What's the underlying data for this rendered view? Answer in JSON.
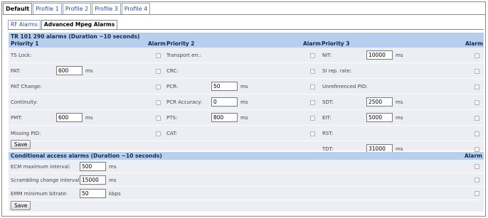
{
  "outer_tabs": [
    "Default",
    "Profile 1",
    "Profile 2",
    "Profile 3",
    "Profile 4"
  ],
  "inner_tabs": [
    "RF Alarms",
    "Advanced Mpeg Alarms"
  ],
  "tr101": {
    "title": "TR 101 290 alarms (Duration ~10 seconds)",
    "headers": {
      "p1": "Priority 1",
      "p2": "Priority 2",
      "p3": "Priority 3",
      "alarm1": "Alarm",
      "alarm2": "Alarm",
      "alarm3": "Alarm"
    },
    "p1": [
      {
        "label": "TS Lock:",
        "value": null,
        "unit": ""
      },
      {
        "label": "PAT:",
        "value": "600",
        "unit": "ms"
      },
      {
        "label": "PAT Change:",
        "value": null,
        "unit": ""
      },
      {
        "label": "Continuity:",
        "value": null,
        "unit": ""
      },
      {
        "label": "PMT:",
        "value": "600",
        "unit": "ms"
      },
      {
        "label": "Missing PID:",
        "value": null,
        "unit": ""
      }
    ],
    "p2": [
      {
        "label": "Transport err.:",
        "value": null,
        "unit": ""
      },
      {
        "label": "CRC:",
        "value": null,
        "unit": ""
      },
      {
        "label": "PCR:",
        "value": "50",
        "unit": "ms"
      },
      {
        "label": "PCR Accuracy:",
        "value": "0",
        "unit": "ms"
      },
      {
        "label": "PTS:",
        "value": "800",
        "unit": "ms"
      },
      {
        "label": "CAT:",
        "value": null,
        "unit": ""
      }
    ],
    "p3": [
      {
        "label": "NIT:",
        "value": "10000",
        "unit": "ms"
      },
      {
        "label": "SI rep. rate:",
        "value": null,
        "unit": ""
      },
      {
        "label": "Unreferenced PID:",
        "value": null,
        "unit": ""
      },
      {
        "label": "SDT:",
        "value": "2500",
        "unit": "ms"
      },
      {
        "label": "EIT:",
        "value": "5000",
        "unit": "ms"
      },
      {
        "label": "RST:",
        "value": null,
        "unit": ""
      },
      {
        "label": "TDT:",
        "value": "31000",
        "unit": "ms"
      }
    ],
    "save_label": "Save"
  },
  "ca": {
    "title": "Conditional access alarms (Duration ~10 seconds)",
    "alarm_header": "Alarm",
    "rows": [
      {
        "label": "ECM maximum interval:",
        "value": "500",
        "unit": "ms"
      },
      {
        "label": "Scrambling change interval:",
        "value": "15000",
        "unit": "ms"
      },
      {
        "label": "EMM minimum bitrate:",
        "value": "50",
        "unit": "kbps"
      }
    ],
    "save_label": "Save"
  }
}
